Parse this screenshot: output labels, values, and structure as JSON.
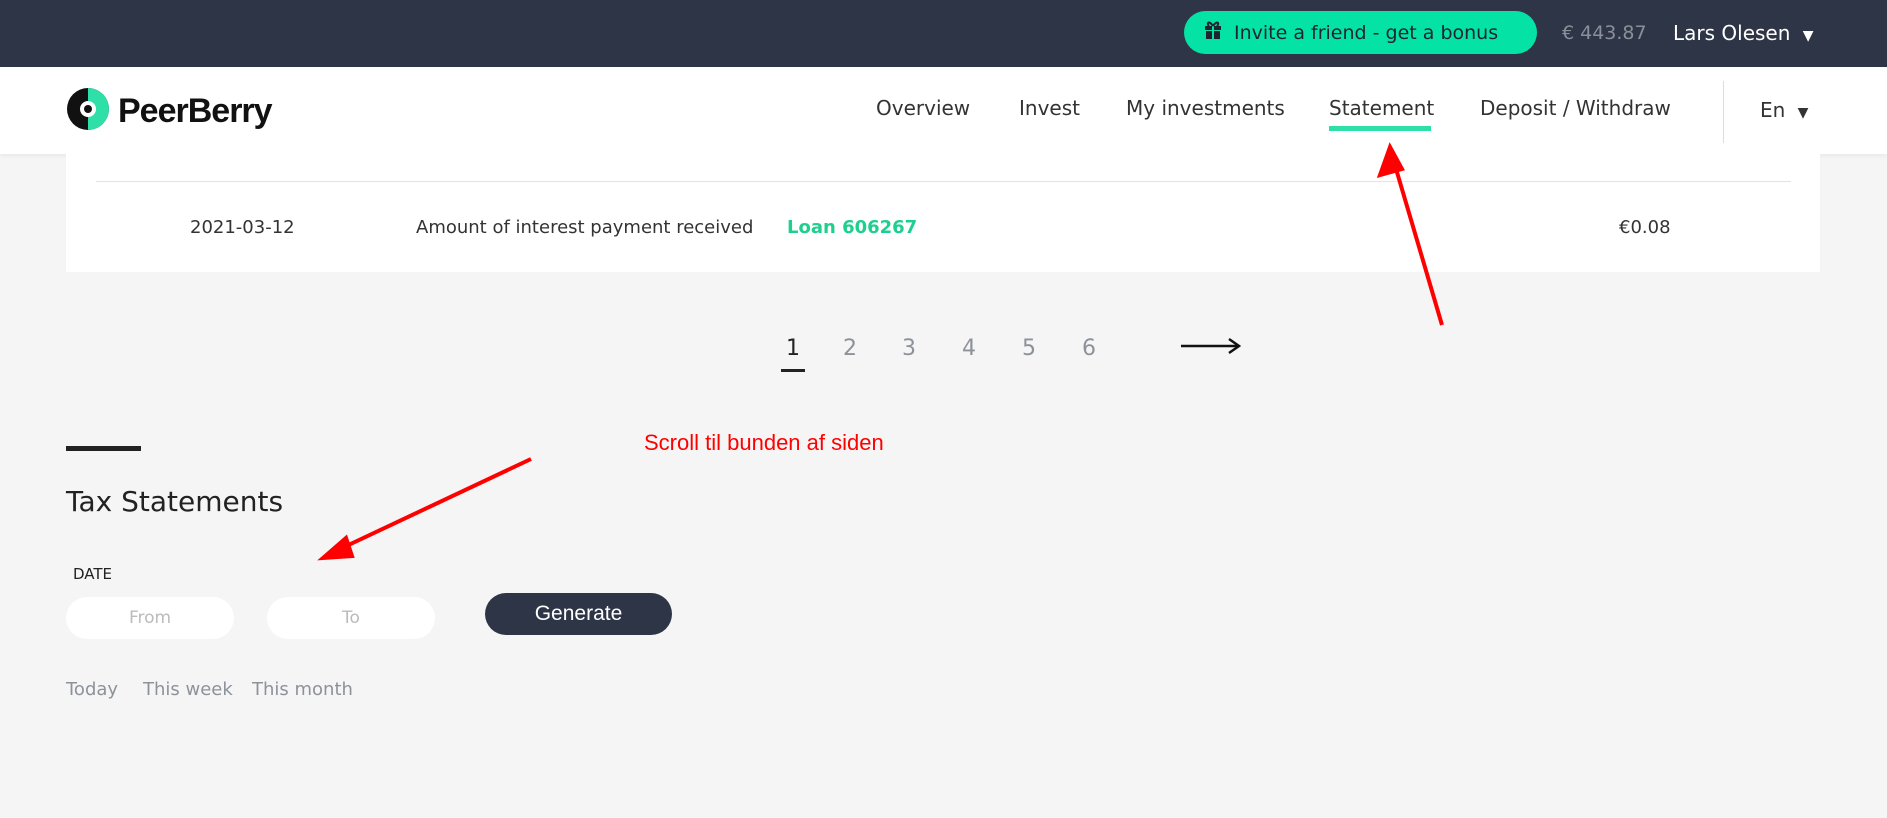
{
  "topbar": {
    "invite_label": "Invite a friend - get a bonus",
    "balance": "€ 443.87",
    "user": "Lars Olesen"
  },
  "nav": {
    "brand": "PeerBerry",
    "items": [
      {
        "label": "Overview"
      },
      {
        "label": "Invest"
      },
      {
        "label": "My investments"
      },
      {
        "label": "Statement",
        "active": true
      },
      {
        "label": "Deposit / Withdraw"
      }
    ],
    "language": "En"
  },
  "statement_row": {
    "date": "2021-03-12",
    "description": "Amount of interest payment received",
    "loan": "Loan 606267",
    "amount": "€0.08"
  },
  "pagination": {
    "pages": [
      "1",
      "2",
      "3",
      "4",
      "5",
      "6"
    ],
    "current": "1",
    "next": "⟶"
  },
  "annotation": {
    "text": "Scroll til bunden af siden",
    "color": "#ff0000"
  },
  "tax": {
    "title": "Tax Statements",
    "date_label": "DATE",
    "from_placeholder": "From",
    "to_placeholder": "To",
    "generate_label": "Generate",
    "quick": [
      "Today",
      "This week",
      "This month"
    ]
  },
  "colors": {
    "accent": "#05e2a6",
    "dark": "#2e3546",
    "link": "#1fcf8e"
  }
}
